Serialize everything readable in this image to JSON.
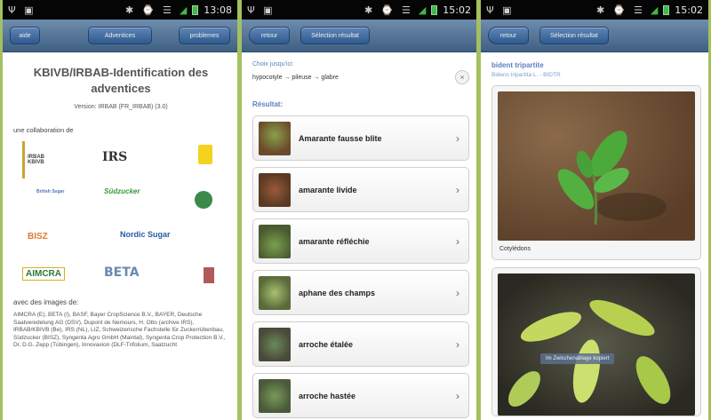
{
  "panels": [
    {
      "status": {
        "time": "13:08",
        "left_icons": "Ψ ▣",
        "right_icons": "✱ ⌚ ☰"
      },
      "nav": {
        "left": "aide",
        "center": "Adventices",
        "right": "problemes"
      },
      "title": "KBIVB/IRBAB-Identification des adventices",
      "version": "Version: IRBAB (FR_IRBAB) (3.0)",
      "collab_label": "une collaboration de",
      "logos": [
        "IRBAB KBIVB",
        "IRS",
        "British Sugar",
        "Südzucker",
        "BISZ",
        "Nordic Sugar",
        "AIMCRA",
        "BETA"
      ],
      "images_label": "avec des images de:",
      "credits": "AIMCRA (E), BETA (I), BASF, Bayer CropScience B.V., BAYER, Deutsche Saatveredelung AG (DSV), Dupont de Nemours, H. Otto (archive IRS), IRBAB/KBIVB (Be), IRS (NL), LIZ, Schweizerische Fachstelle für Zuckerrübenbau, Südzucker (BISZ), Syngenta Agro GmbH (Maintal), Syngenta Crop Protection B.V., Dr. D.G. Zepp (Tübingen), Innovaxion (DLF-Trifolium, Saatzucht"
    },
    {
      "status": {
        "time": "15:02",
        "left_icons": "Ψ ▣",
        "right_icons": "✱ ⌚ ☰"
      },
      "nav": {
        "left": "retour",
        "center": "Sélection résultat"
      },
      "choice_label": "Choix jusqu'ici:",
      "choice_value": "hypocotyle → pileuse → glabre",
      "clear": "×",
      "result_label": "Résultat:",
      "results": [
        {
          "label": "Amarante fausse blite",
          "thumb": "#7a5a3a"
        },
        {
          "label": "amarante livide",
          "thumb": "#8a4a2a"
        },
        {
          "label": "amarante réfléchie",
          "thumb": "#5a7a3a"
        },
        {
          "label": "aphane des champs",
          "thumb": "#6a8a4a"
        },
        {
          "label": "arroche étalée",
          "thumb": "#4a6a3a"
        },
        {
          "label": "arroche hastée",
          "thumb": "#5a7a4a"
        }
      ]
    },
    {
      "status": {
        "time": "15:02",
        "left_icons": "Ψ ▣",
        "right_icons": "✱ ⌚ ☰"
      },
      "nav": {
        "left": "retour",
        "center": "Sélection résultat"
      },
      "species": "bident tripartite",
      "scientific": "Bidens tripartita L. - BIDTR",
      "photo1_caption": "Cotylédons",
      "photo2_tooltip": "Im Zwischenablage kopiert"
    }
  ]
}
